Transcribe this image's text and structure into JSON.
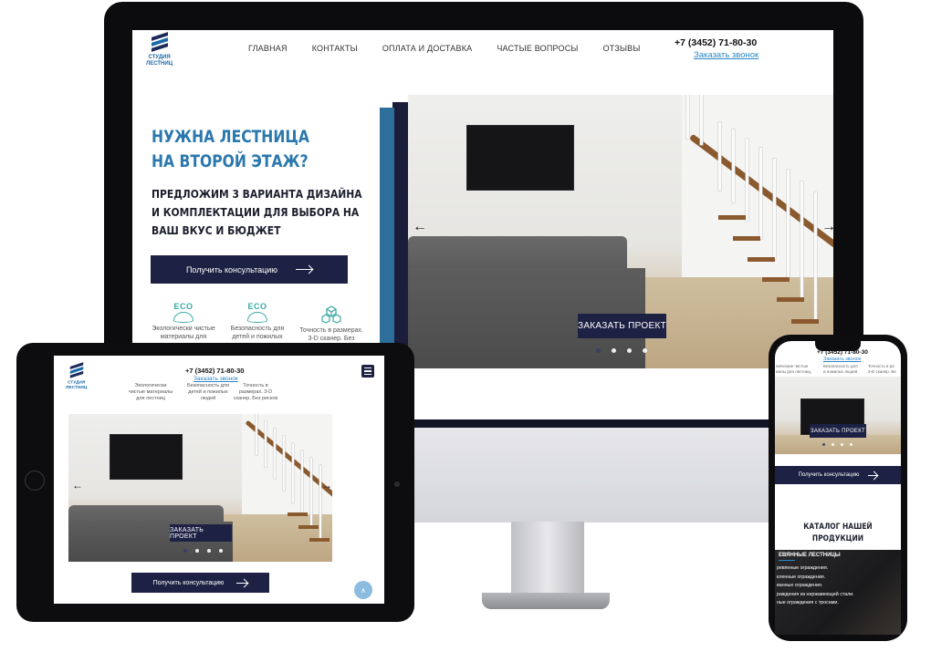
{
  "desktop": {
    "logo_text": "СТУДИЯ\nЛЕСТНИЦ",
    "nav": [
      "ГЛАВНАЯ",
      "КОНТАКТЫ",
      "ОПЛАТА И ДОСТАВКА",
      "ЧАСТЫЕ ВОПРОСЫ",
      "ОТЗЫВЫ"
    ],
    "phone": "+7 (3452) 71-80-30",
    "callback": "Заказать звонок",
    "hero_title_1": "НУЖНА ЛЕСТНИЦА",
    "hero_title_2": "НА ВТОРОЙ ЭТАЖ?",
    "hero_sub_1": "ПРЕДЛОЖИМ 3 ВАРИАНТА ДИЗАЙНА",
    "hero_sub_2": "И КОМПЛЕКТАЦИИ ДЛЯ ВЫБОРА НА",
    "hero_sub_3": "ВАШ ВКУС И БЮДЖЕТ",
    "consult_button": "Получить консультацию",
    "features": [
      {
        "badge": "ECO",
        "text": "Экологически чистые\nматериалы для"
      },
      {
        "badge": "ECO",
        "text": "Безопасность для\nдетей и пожилых"
      },
      {
        "badge": "",
        "text": "Точность в размерах.\n3-D сканер. Без"
      }
    ],
    "order_button": "ЗАКАЗАТЬ ПРОЕКТ",
    "slider_prev": "←",
    "slider_next": "→",
    "slider_active_index": 0,
    "slider_count": 4
  },
  "tablet": {
    "logo_text": "СТУДИЯ\nЛЕСТНИЦ",
    "phone": "+7 (3452) 71-80-30",
    "callback": "Заказать звонок",
    "features": [
      {
        "text": "Экологически\nчистые материалы\nдля лестниц"
      },
      {
        "text": "Безопасность для\nдетей и пожилых\nлюдей"
      },
      {
        "text": "Точность в\nразмерах. 3-D\nсканер. Без рисков"
      }
    ],
    "order_button": "ЗАКАЗАТЬ ПРОЕКТ",
    "consult_button": "Получить консультацию",
    "slider_prev": "←",
    "slider_next": "→",
    "scroll_top": "∧"
  },
  "phone": {
    "phone": "+7 (3452) 71-80-30",
    "callback": "Заказать звонок",
    "partial_left": "нические чистые\nиалы для лестниц.",
    "partial_mid": "Безопасность для\nи пожилых людей",
    "partial_right": "Точность в ра\n3-D сканер. Бе",
    "order_button": "ЗАКАЗАТЬ ПРОЕКТ",
    "consult_button": "Получить консультацию",
    "catalog_title": "КАТАЛОГ НАШЕЙ\nПРОДУКЦИИ",
    "catalog_heading": "ЕВЯННЫЕ ЛЕСТНИЦЫ",
    "catalog_items": [
      "ревянные ограждения.",
      "кленные ограждения.",
      "ванные ограждения.",
      "раждения из нержавеющей стали.",
      "ные ограждения с тросами."
    ]
  }
}
